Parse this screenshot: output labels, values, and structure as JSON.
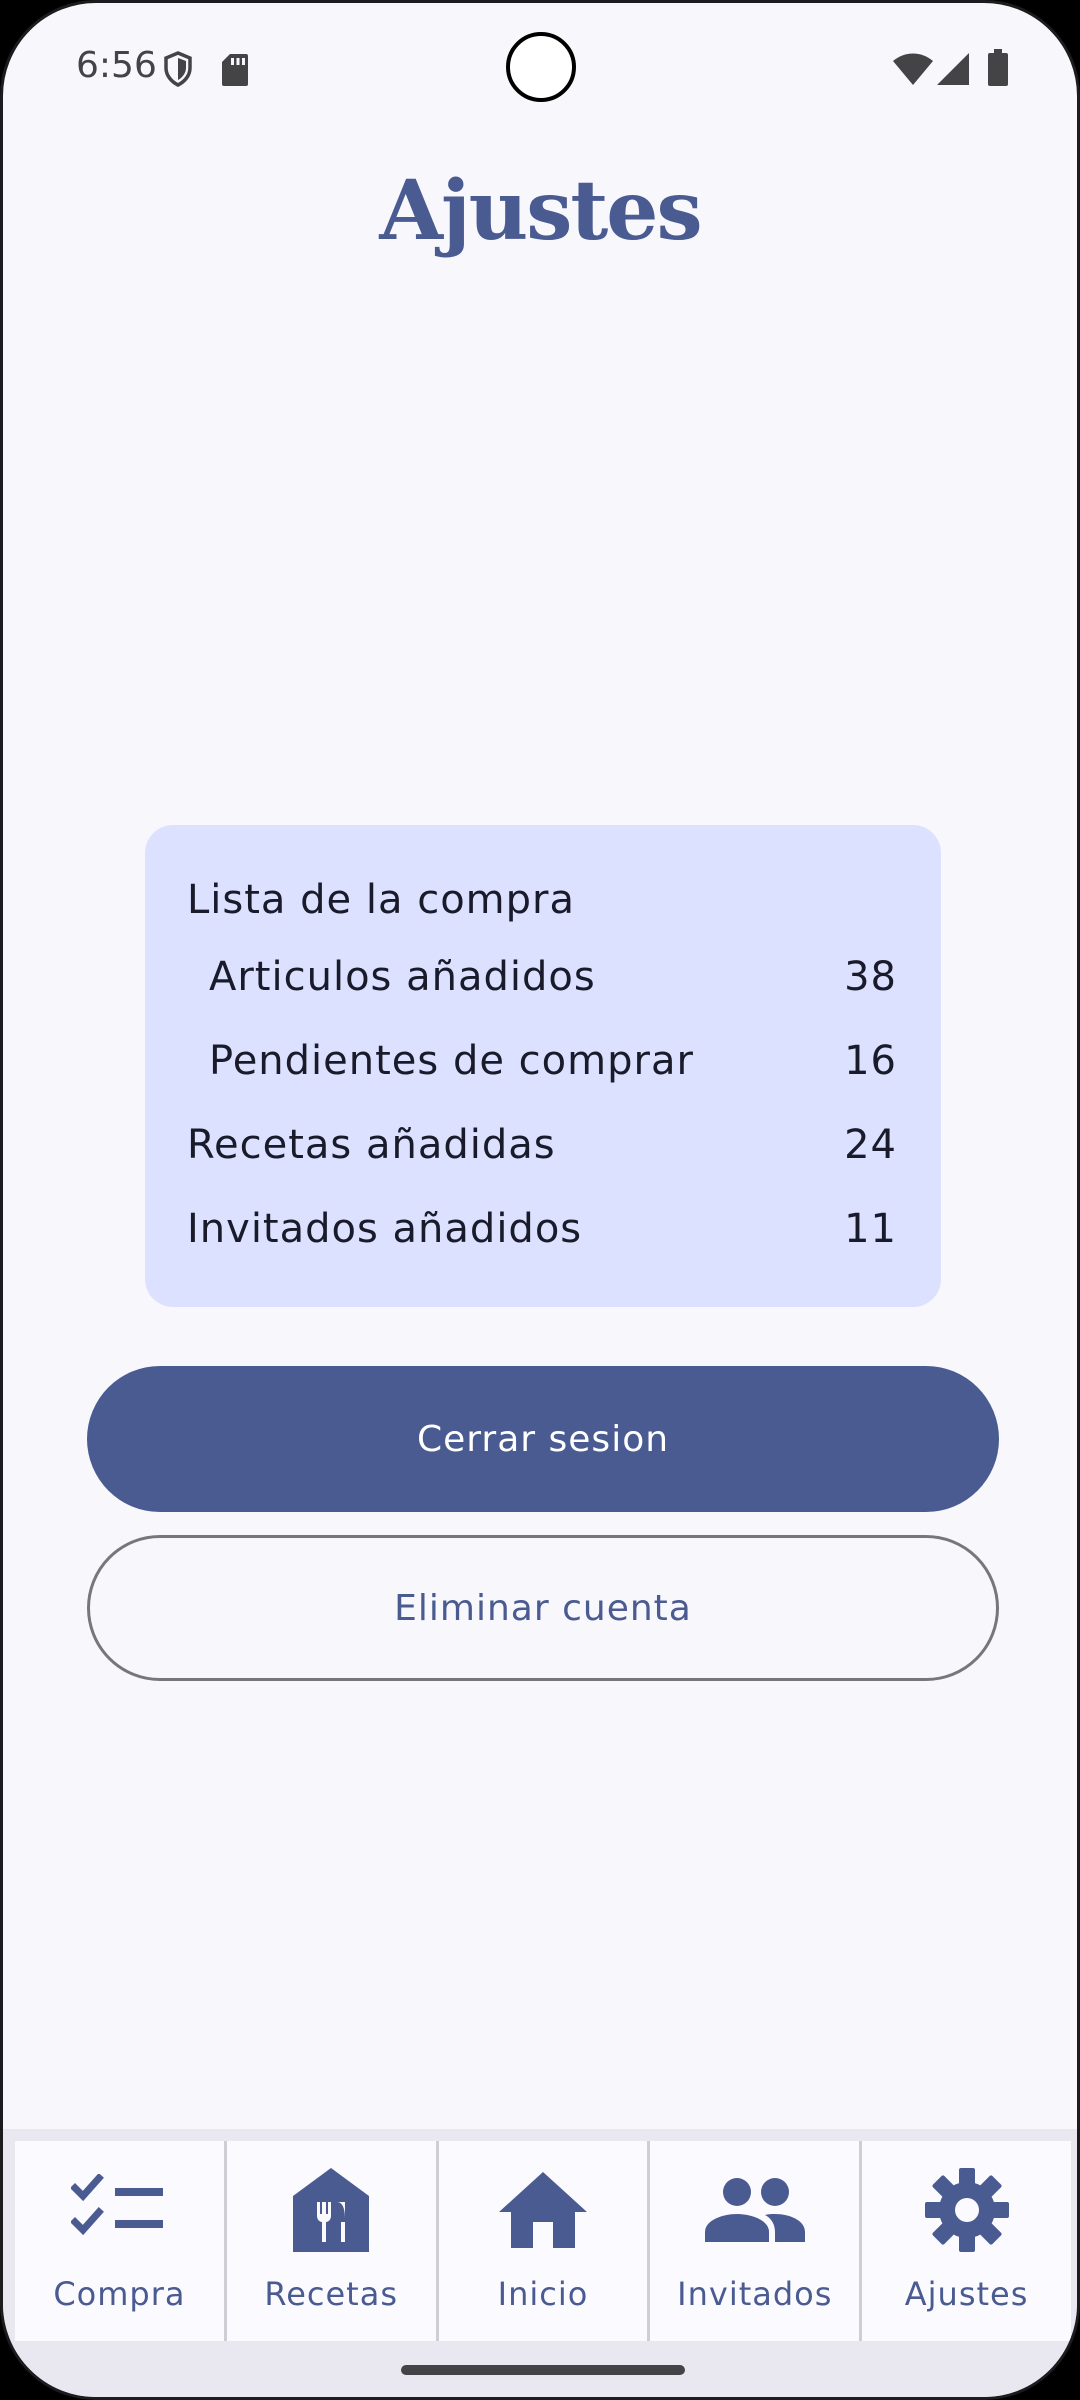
{
  "status_bar": {
    "time": "6:56",
    "icons": [
      "shield-icon",
      "sd-card-icon",
      "wifi-icon",
      "signal-icon",
      "battery-icon"
    ]
  },
  "header": {
    "title": "Ajustes"
  },
  "stats": {
    "rows": [
      {
        "label": "Lista de la compra",
        "value": ""
      },
      {
        "label": "Articulos añadidos",
        "value": "38"
      },
      {
        "label": "Pendientes de comprar",
        "value": "16"
      },
      {
        "label": "Recetas añadidas",
        "value": "24"
      },
      {
        "label": "Invitados añadidos",
        "value": "11"
      }
    ]
  },
  "actions": {
    "logout_label": "Cerrar sesion",
    "delete_label": "Eliminar cuenta"
  },
  "nav": {
    "items": [
      {
        "label": "Compra",
        "icon": "checklist-icon"
      },
      {
        "label": "Recetas",
        "icon": "restaurant-icon"
      },
      {
        "label": "Inicio",
        "icon": "home-icon"
      },
      {
        "label": "Invitados",
        "icon": "people-icon"
      },
      {
        "label": "Ajustes",
        "icon": "settings-gear-icon"
      }
    ]
  },
  "colors": {
    "primary": "#4a5b91",
    "card_background": "#dbe1ff",
    "page_background": "#f8f7fc",
    "nav_background": "#e9e7f0"
  }
}
